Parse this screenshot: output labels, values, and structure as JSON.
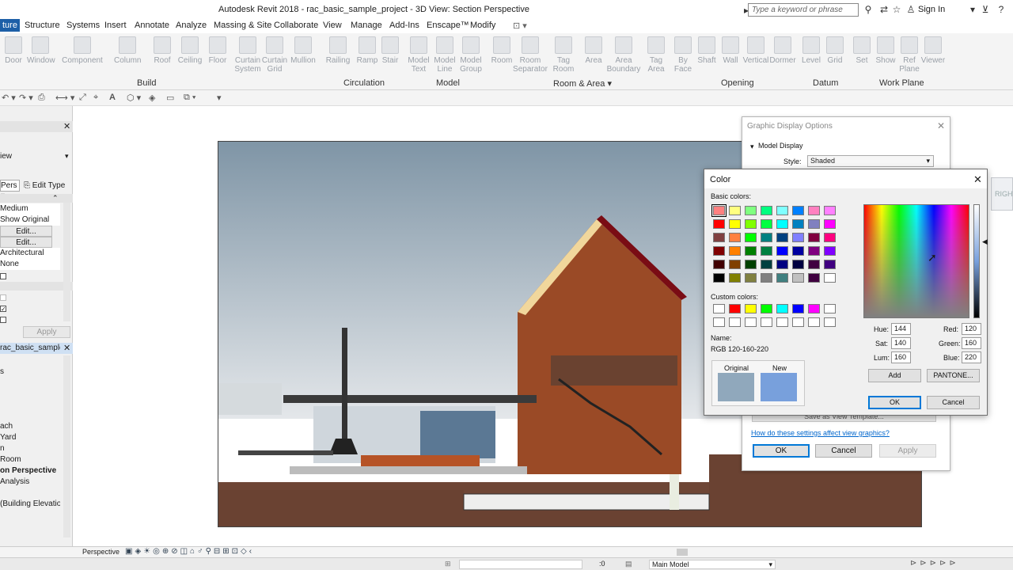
{
  "app": {
    "title": "Autodesk Revit 2018 -    rac_basic_sample_project - 3D View: Section Perspective",
    "search_placeholder": "Type a keyword or phrase",
    "sign_in": "Sign In"
  },
  "menu": [
    "ture",
    "Structure",
    "Systems",
    "Insert",
    "Annotate",
    "Analyze",
    "Massing & Site",
    "Collaborate",
    "View",
    "Manage",
    "Add-Ins",
    "Enscape™",
    "Modify"
  ],
  "ribbon": {
    "tools": [
      "Door",
      "Window",
      "Component",
      "Column",
      "Roof",
      "Ceiling",
      "Floor",
      "Curtain System",
      "Curtain Grid",
      "Mullion",
      "Railing",
      "Ramp",
      "Stair",
      "Model Text",
      "Model Line",
      "Model Group",
      "Room",
      "Room Separator",
      "Tag Room",
      "Area",
      "Area Boundary",
      "Tag Area",
      "By Face",
      "Shaft",
      "Wall",
      "Vertical",
      "Dormer",
      "Level",
      "Grid",
      "Set",
      "Show",
      "Ref Plane",
      "Viewer"
    ],
    "panels": [
      "Build",
      "Circulation",
      "Model",
      "Room & Area ▾",
      "Opening",
      "Datum",
      "Work Plane"
    ]
  },
  "properties": {
    "close": "✕",
    "view_label": "iew",
    "type_selector": "Pers",
    "edit_type": "Edit Type",
    "rows": [
      "Medium",
      "Show Original",
      "Edit...",
      "Edit...",
      "Architectural",
      "None"
    ],
    "apply": "Apply"
  },
  "browser": {
    "title": "rac_basic_sample_...",
    "items": [
      "s",
      "",
      "",
      "",
      "ach",
      "Yard",
      "n",
      "Room",
      "on Perspective",
      "Analysis",
      "(Building Elevation"
    ]
  },
  "view_controls": {
    "scale": "Perspective"
  },
  "status": {
    "model": "Main Model",
    "zero": ":0"
  },
  "gdo": {
    "title": "Graphic Display Options",
    "section": "Model Display",
    "style_label": "Style:",
    "style_value": "Shaded",
    "link": "How do these settings affect view graphics?",
    "ok": "OK",
    "cancel": "Cancel",
    "apply": "Apply",
    "save_template": "Save as View Template...",
    "right_tag": "RIGHT"
  },
  "color_dialog": {
    "title": "Color",
    "basic_colors": "Basic colors:",
    "custom_colors": "Custom colors:",
    "name_label": "Name:",
    "name_value": "RGB 120-160-220",
    "original": "Original",
    "new": "New",
    "hue_label": "Hue:",
    "hue": "144",
    "sat_label": "Sat:",
    "sat": "140",
    "lum_label": "Lum:",
    "lum": "160",
    "red_label": "Red:",
    "red": "120",
    "green_label": "Green:",
    "green": "160",
    "blue_label": "Blue:",
    "blue": "220",
    "add": "Add",
    "pantone": "PANTONE...",
    "ok": "OK",
    "cancel": "Cancel",
    "basic": [
      "#ff8080",
      "#ffff80",
      "#80ff80",
      "#00ff80",
      "#80ffff",
      "#0080ff",
      "#ff80c0",
      "#ff80ff",
      "#ff0000",
      "#ffff00",
      "#80ff00",
      "#00ff40",
      "#00ffff",
      "#0080c0",
      "#8080c0",
      "#ff00ff",
      "#804040",
      "#ff8040",
      "#00ff00",
      "#008080",
      "#004080",
      "#8080ff",
      "#800040",
      "#ff0080",
      "#800000",
      "#ff8000",
      "#008000",
      "#008040",
      "#0000ff",
      "#0000a0",
      "#800080",
      "#8000ff",
      "#400000",
      "#804000",
      "#004000",
      "#004040",
      "#000080",
      "#000040",
      "#400040",
      "#400080",
      "#000000",
      "#808000",
      "#808040",
      "#808080",
      "#408080",
      "#c0c0c0",
      "#400040",
      "#ffffff"
    ],
    "custom": [
      "#ffffff",
      "#ff0000",
      "#ffff00",
      "#00ff00",
      "#00ffff",
      "#0000ff",
      "#ff00ff",
      "#ffffff",
      "#ffffff",
      "#ffffff",
      "#ffffff",
      "#ffffff",
      "#ffffff",
      "#ffffff",
      "#ffffff",
      "#ffffff"
    ],
    "original_color": "#90a8bc",
    "new_color": "#78a0dc"
  }
}
